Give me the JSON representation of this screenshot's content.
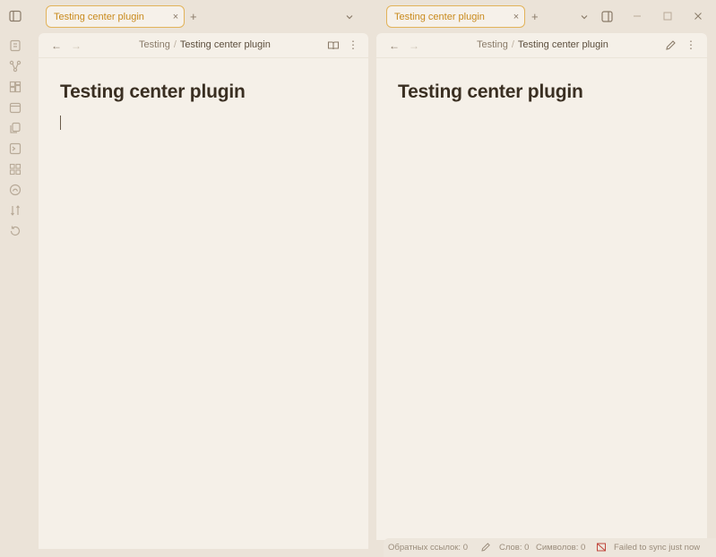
{
  "tabs": {
    "left": {
      "title": "Testing center plugin",
      "close": "×"
    },
    "right": {
      "title": "Testing center plugin",
      "close": "×"
    },
    "new_tab": "+"
  },
  "panes": {
    "left": {
      "back": "←",
      "forward": "→",
      "breadcrumb": {
        "folder": "Testing",
        "separator": "/",
        "file": "Testing center plugin"
      },
      "more": "⋮",
      "title": "Testing center plugin"
    },
    "right": {
      "back": "←",
      "forward": "→",
      "breadcrumb": {
        "folder": "Testing",
        "separator": "/",
        "file": "Testing center plugin"
      },
      "more": "⋮",
      "title": "Testing center plugin"
    }
  },
  "statusbar": {
    "backlinks": "Обратных ссылок: 0",
    "words": "Слов: 0",
    "chars": "Символов: 0",
    "sync": "Failed to sync just now"
  },
  "colors": {
    "accent": "#e2b35a",
    "background": "#ebe3d8",
    "pane": "#f5f0e8"
  },
  "icons": [
    "sidebar-toggle-icon",
    "open-note-icon",
    "graph-icon",
    "canvas-icon",
    "calendar-icon",
    "templates-icon",
    "terminal-icon",
    "dice-icon",
    "publish-icon",
    "sort-icon",
    "history-icon",
    "reading-mode-icon",
    "edit-icon",
    "more-icon",
    "sync-failed-icon"
  ]
}
